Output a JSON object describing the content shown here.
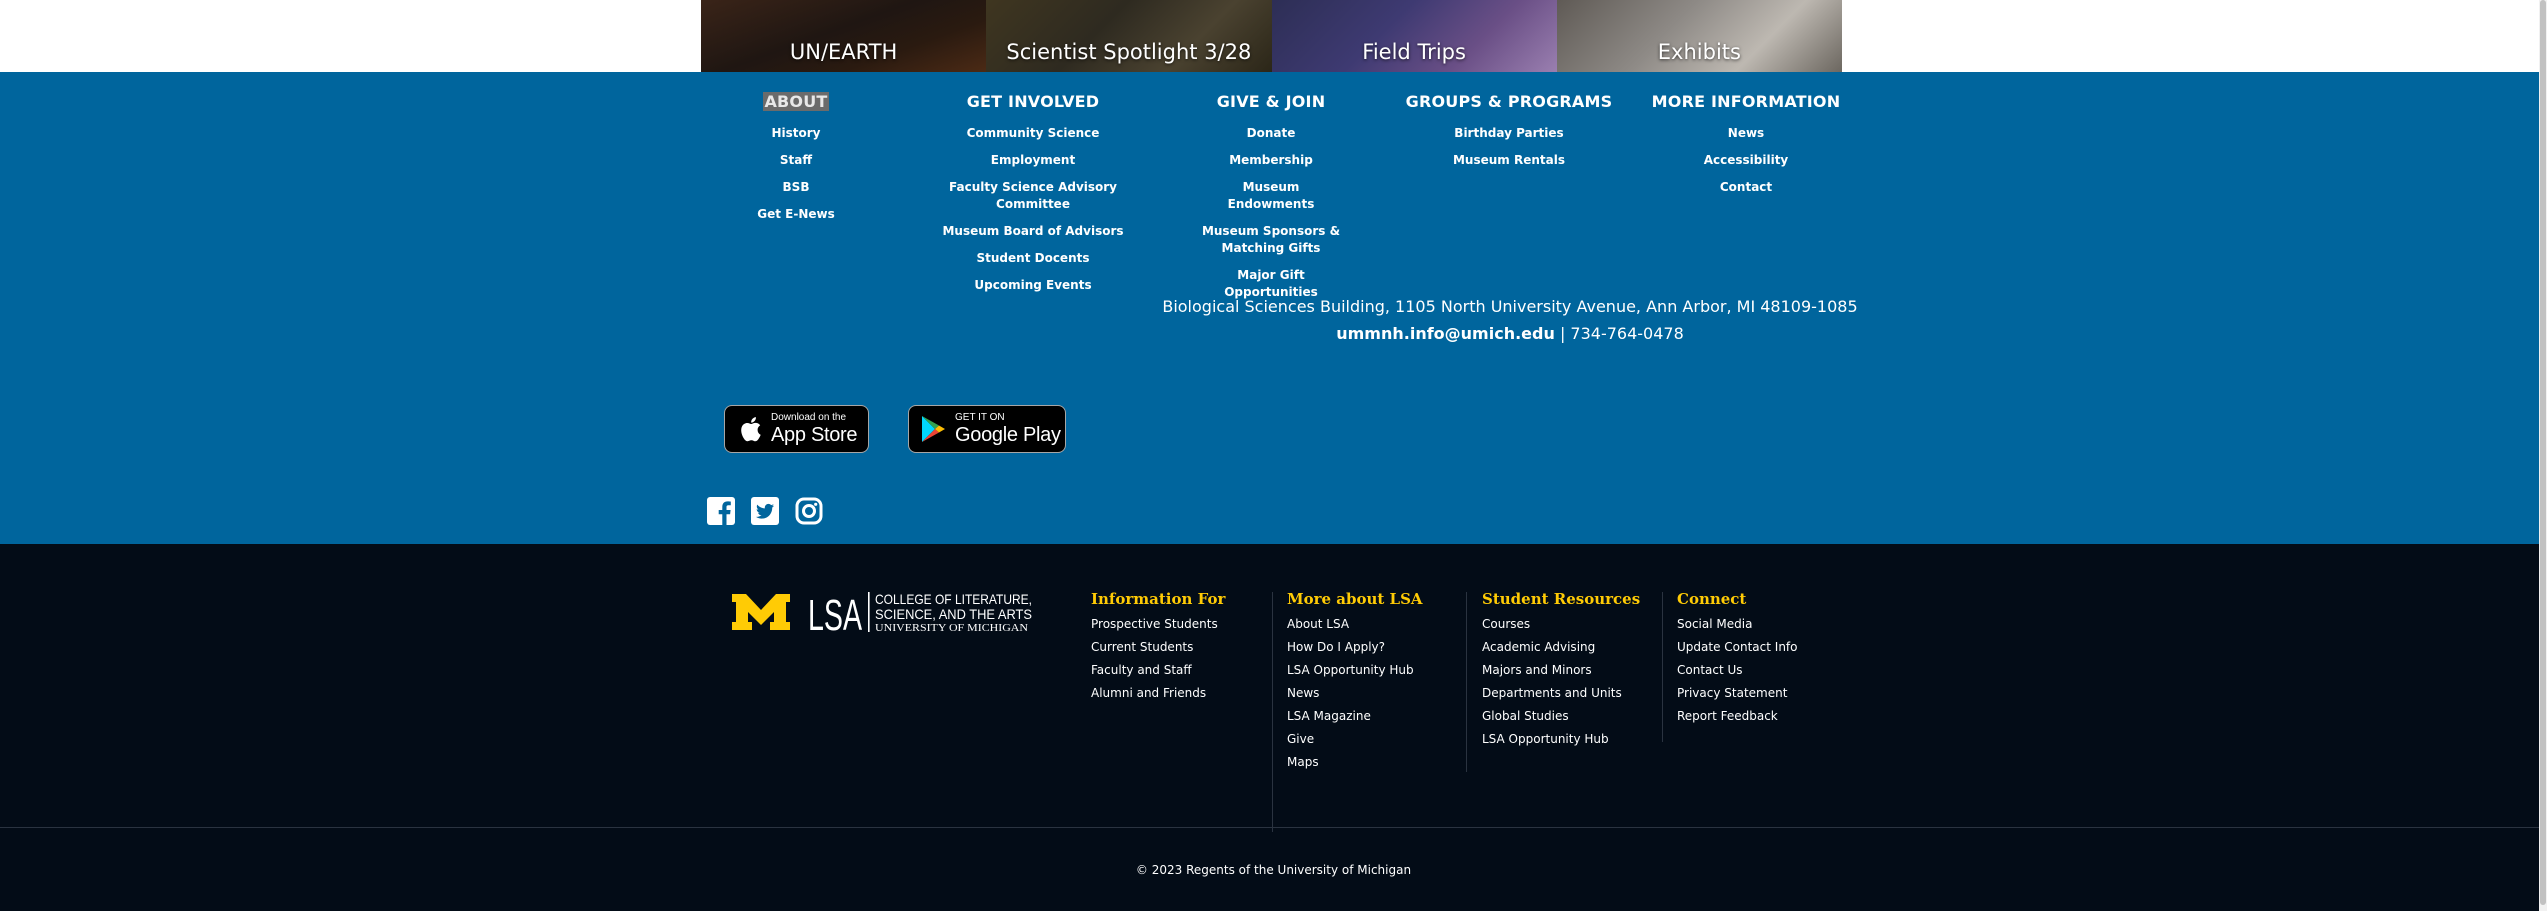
{
  "hero_tiles": [
    "UN/EARTH",
    "Scientist Spotlight 3/28",
    "Field Trips",
    "Exhibits"
  ],
  "museum_footer": {
    "columns": [
      {
        "heading": "ABOUT",
        "links": [
          "History",
          "Staff",
          "BSB",
          "Get E-News"
        ]
      },
      {
        "heading": "GET INVOLVED",
        "links": [
          "Community Science",
          "Employment",
          "Faculty Science Advisory Committee",
          "Museum Board of Advisors",
          "Student Docents",
          "Upcoming Events"
        ]
      },
      {
        "heading": "GIVE & JOIN",
        "links": [
          "Donate",
          "Membership",
          "Museum Endowments",
          "Museum Sponsors & Matching Gifts",
          "Major Gift Opportunities"
        ]
      },
      {
        "heading": "GROUPS & PROGRAMS",
        "links": [
          "Birthday Parties",
          "Museum Rentals"
        ]
      },
      {
        "heading": "MORE INFORMATION",
        "links": [
          "News",
          "Accessibility",
          "Contact"
        ]
      }
    ],
    "address": "Biological Sciences Building, 1105 North University Avenue, Ann Arbor, MI 48109-1085",
    "email": "ummnh.info@umich.edu",
    "phone_separator": " | ",
    "phone": "734-764-0478",
    "app_store": {
      "small": "Download on the",
      "big": "App Store"
    },
    "google_play": {
      "small": "GET IT ON",
      "big": "Google Play"
    },
    "social_icons": [
      "facebook-icon",
      "twitter-icon",
      "instagram-icon"
    ]
  },
  "lsa_footer": {
    "logo": {
      "mark": "M",
      "lsa": "LSA",
      "line1": "COLLEGE OF LITERATURE,",
      "line2": "SCIENCE, AND THE ARTS",
      "line3": "UNIVERSITY OF MICHIGAN"
    },
    "columns": [
      {
        "heading": "Information For",
        "links": [
          "Prospective Students",
          "Current Students",
          "Faculty and Staff",
          "Alumni and Friends"
        ]
      },
      {
        "heading": "More about LSA",
        "links": [
          "About LSA",
          "How Do I Apply?",
          "LSA Opportunity Hub",
          "News",
          "LSA Magazine",
          "Give",
          "Maps"
        ]
      },
      {
        "heading": "Student Resources",
        "links": [
          "Courses",
          "Academic Advising",
          "Majors and Minors",
          "Departments and Units",
          "Global Studies",
          "LSA Opportunity Hub"
        ]
      },
      {
        "heading": "Connect",
        "links": [
          "Social Media",
          "Update Contact Info",
          "Contact Us",
          "Privacy Statement",
          "Report Feedback"
        ]
      }
    ],
    "copyright": "© 2023 Regents of the University of Michigan"
  },
  "colors": {
    "museum_blue": "#00659d",
    "lsa_dark": "#030c17",
    "maize": "#ffcb05"
  }
}
